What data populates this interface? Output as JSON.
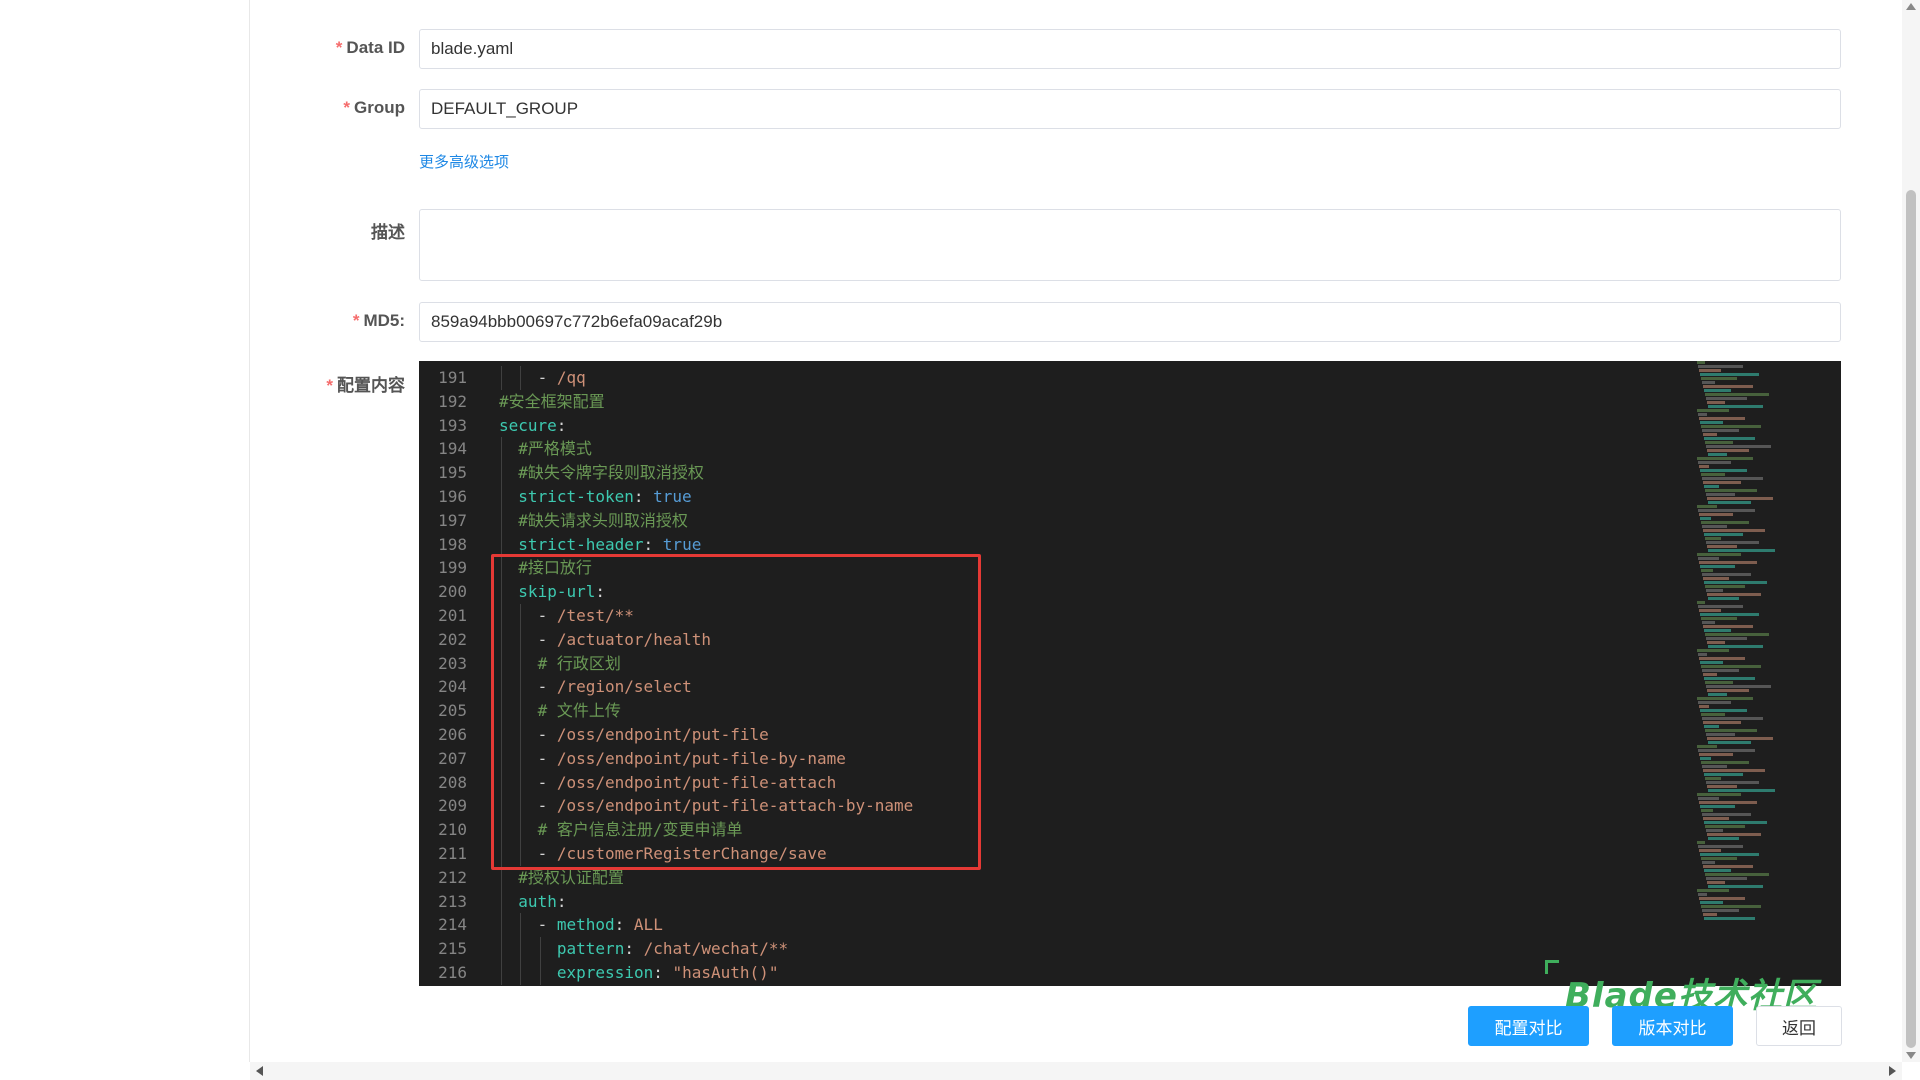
{
  "form": {
    "data_id": {
      "label": "Data ID",
      "value": "blade.yaml"
    },
    "group": {
      "label": "Group",
      "value": "DEFAULT_GROUP"
    },
    "more_options": "更多高级选项",
    "description": {
      "label": "描述",
      "value": ""
    },
    "md5": {
      "label": "MD5:",
      "value": "859a94bbb00697c772b6efa09acaf29b"
    },
    "content": {
      "label": "配置内容"
    }
  },
  "editor": {
    "lines": [
      {
        "n": "191",
        "indent": 2,
        "parts": [
          [
            "c-punct",
            "- "
          ],
          [
            "c-str",
            "/qq"
          ]
        ]
      },
      {
        "n": "192",
        "indent": 0,
        "parts": [
          [
            "c-comment",
            "#安全框架配置"
          ]
        ]
      },
      {
        "n": "193",
        "indent": 0,
        "parts": [
          [
            "c-key",
            "secure"
          ],
          [
            "c-punct",
            ":"
          ]
        ]
      },
      {
        "n": "194",
        "indent": 1,
        "parts": [
          [
            "c-comment",
            "#严格模式"
          ]
        ]
      },
      {
        "n": "195",
        "indent": 1,
        "parts": [
          [
            "c-comment",
            "#缺失令牌字段则取消授权"
          ]
        ]
      },
      {
        "n": "196",
        "indent": 1,
        "parts": [
          [
            "c-key",
            "strict-token"
          ],
          [
            "c-punct",
            ": "
          ],
          [
            "c-bool",
            "true"
          ]
        ]
      },
      {
        "n": "197",
        "indent": 1,
        "parts": [
          [
            "c-comment",
            "#缺失请求头则取消授权"
          ]
        ]
      },
      {
        "n": "198",
        "indent": 1,
        "parts": [
          [
            "c-key",
            "strict-header"
          ],
          [
            "c-punct",
            ": "
          ],
          [
            "c-bool",
            "true"
          ]
        ]
      },
      {
        "n": "199",
        "indent": 1,
        "parts": [
          [
            "c-comment",
            "#接口放行"
          ]
        ]
      },
      {
        "n": "200",
        "indent": 1,
        "parts": [
          [
            "c-key",
            "skip-url"
          ],
          [
            "c-punct",
            ":"
          ]
        ]
      },
      {
        "n": "201",
        "indent": 2,
        "parts": [
          [
            "c-punct",
            "- "
          ],
          [
            "c-str",
            "/test/**"
          ]
        ]
      },
      {
        "n": "202",
        "indent": 2,
        "parts": [
          [
            "c-punct",
            "- "
          ],
          [
            "c-str",
            "/actuator/health"
          ]
        ]
      },
      {
        "n": "203",
        "indent": 2,
        "parts": [
          [
            "c-comment",
            "# 行政区划"
          ]
        ]
      },
      {
        "n": "204",
        "indent": 2,
        "parts": [
          [
            "c-punct",
            "- "
          ],
          [
            "c-str",
            "/region/select"
          ]
        ]
      },
      {
        "n": "205",
        "indent": 2,
        "parts": [
          [
            "c-comment",
            "# 文件上传"
          ]
        ]
      },
      {
        "n": "206",
        "indent": 2,
        "parts": [
          [
            "c-punct",
            "- "
          ],
          [
            "c-str",
            "/oss/endpoint/put-file"
          ]
        ]
      },
      {
        "n": "207",
        "indent": 2,
        "parts": [
          [
            "c-punct",
            "- "
          ],
          [
            "c-str",
            "/oss/endpoint/put-file-by-name"
          ]
        ]
      },
      {
        "n": "208",
        "indent": 2,
        "parts": [
          [
            "c-punct",
            "- "
          ],
          [
            "c-str",
            "/oss/endpoint/put-file-attach"
          ]
        ]
      },
      {
        "n": "209",
        "indent": 2,
        "parts": [
          [
            "c-punct",
            "- "
          ],
          [
            "c-str",
            "/oss/endpoint/put-file-attach-by-name"
          ]
        ]
      },
      {
        "n": "210",
        "indent": 2,
        "parts": [
          [
            "c-comment",
            "# 客户信息注册/变更申请单"
          ]
        ]
      },
      {
        "n": "211",
        "indent": 2,
        "parts": [
          [
            "c-punct",
            "- "
          ],
          [
            "c-str",
            "/customerRegisterChange/save"
          ]
        ]
      },
      {
        "n": "212",
        "indent": 1,
        "parts": [
          [
            "c-comment",
            "#授权认证配置"
          ]
        ]
      },
      {
        "n": "213",
        "indent": 1,
        "parts": [
          [
            "c-key",
            "auth"
          ],
          [
            "c-punct",
            ":"
          ]
        ]
      },
      {
        "n": "214",
        "indent": 2,
        "parts": [
          [
            "c-punct",
            "- "
          ],
          [
            "c-key",
            "method"
          ],
          [
            "c-punct",
            ": "
          ],
          [
            "c-str",
            "ALL"
          ]
        ]
      },
      {
        "n": "215",
        "indent": 3,
        "parts": [
          [
            "c-key",
            "pattern"
          ],
          [
            "c-punct",
            ": "
          ],
          [
            "c-str",
            "/chat/wechat/**"
          ]
        ]
      },
      {
        "n": "216",
        "indent": 3,
        "parts": [
          [
            "c-key",
            "expression"
          ],
          [
            "c-punct",
            ": "
          ],
          [
            "c-str",
            "\"hasAuth()\""
          ]
        ]
      }
    ]
  },
  "watermark": "Blade技术社区",
  "buttons": {
    "compare_config": "配置对比",
    "compare_version": "版本对比",
    "back": "返回"
  },
  "colors": {
    "primary": "#1e9fff",
    "required": "#f56c6c",
    "editor_bg": "#1e1e1e",
    "highlight": "#e53935",
    "watermark": "#3fae5c"
  }
}
